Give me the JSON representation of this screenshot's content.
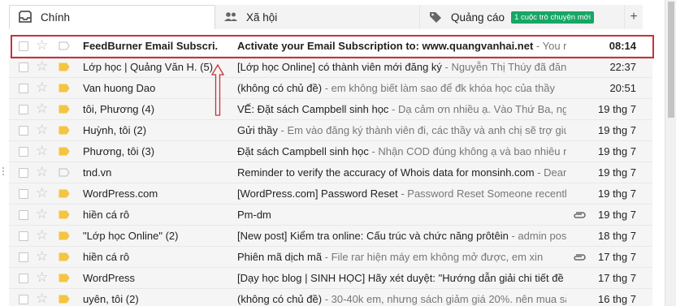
{
  "tabs": [
    {
      "label": "Chính",
      "icon": "inbox-icon"
    },
    {
      "label": "Xã hội",
      "icon": "people-icon"
    },
    {
      "label": "Quảng cáo",
      "icon": "tag-icon",
      "badge": "1 cuộc trò chuyện mới"
    }
  ],
  "add_tab_label": "+",
  "emails": [
    {
      "from": "FeedBurner Email Subscri.",
      "subject": "Activate your Email Subscription to: www.quangvanhai.net",
      "snippet": " - You r",
      "date": "08:14",
      "unread": true,
      "important": false,
      "attachment": false
    },
    {
      "from": "Lớp học | Quảng Văn H. (5)",
      "subject": "[Lớp học Online] có thành viên mới đăng ký",
      "snippet": " - Nguyễn Thị Thúy đã đăng",
      "date": "22:37",
      "unread": false,
      "important": true,
      "attachment": false
    },
    {
      "from": "Van huong Dao",
      "subject": "(không có chủ đề)",
      "snippet": " - em không biết làm sao để đk khóa học của thầy",
      "date": "20:51",
      "unread": false,
      "important": true,
      "attachment": false
    },
    {
      "from": "tôi, Phương (4)",
      "subject": "VẾ: Đặt sách Campbell sinh học",
      "snippet": " - Dạ cảm ơn nhiều ạ. Vào Thứ Ba, ng",
      "date": "19 thg 7",
      "unread": false,
      "important": true,
      "attachment": false
    },
    {
      "from": "Huỳnh, tôi (2)",
      "subject": "Gửi thầy",
      "snippet": " - Em vào đăng ký thành viên đi, các thầy và anh chị sẽ trợ giú",
      "date": "19 thg 7",
      "unread": false,
      "important": true,
      "attachment": false
    },
    {
      "from": "Phương, tôi (3)",
      "subject": "Đặt sách Campbell sinh học",
      "snippet": " - Nhận COD đúng không ạ và bao nhiêu n",
      "date": "19 thg 7",
      "unread": false,
      "important": true,
      "attachment": false
    },
    {
      "from": "tnd.vn",
      "subject": "Reminder to verify the accuracy of Whois data for monsinh.com",
      "snippet": " - Dear",
      "date": "19 thg 7",
      "unread": false,
      "important": false,
      "attachment": false
    },
    {
      "from": "WordPress.com",
      "subject": "[WordPress.com] Password Reset",
      "snippet": " - Password Reset Someone recently",
      "date": "19 thg 7",
      "unread": false,
      "important": true,
      "attachment": false
    },
    {
      "from": "hiền cá rô",
      "subject": "Pm-dm",
      "snippet": "",
      "date": "19 thg 7",
      "unread": false,
      "important": true,
      "attachment": true
    },
    {
      "from": "\"Lớp học Online\" (2)",
      "subject": "[New post] Kiểm tra online: Cấu trúc và chức năng prôtêin",
      "snippet": " - admin pos",
      "date": "18 thg 7",
      "unread": false,
      "important": true,
      "attachment": false
    },
    {
      "from": "hiền cá rô",
      "subject": "Phiên mã dịch mã",
      "snippet": " - File rar hiện máy em không mở được, em xin",
      "date": "17 thg 7",
      "unread": false,
      "important": true,
      "attachment": true
    },
    {
      "from": "WordPress",
      "subject": "[Dạy học blog | SINH HỌC] Hãy xét duyệt: \"Hướng dẫn giải chi tiết đề",
      "snippet": "",
      "date": "17 thg 7",
      "unread": false,
      "important": true,
      "attachment": false
    },
    {
      "from": "uyên, tôi (2)",
      "subject": "(không có chủ đề)",
      "snippet": " - 30-40k em, nhưng sách giảm giá 20%. nên mua sẵ",
      "date": "16 thg 7",
      "unread": false,
      "important": true,
      "attachment": false
    }
  ],
  "colors": {
    "important": "#f4c542",
    "badge": "#16a765",
    "highlight": "#c9313b"
  }
}
